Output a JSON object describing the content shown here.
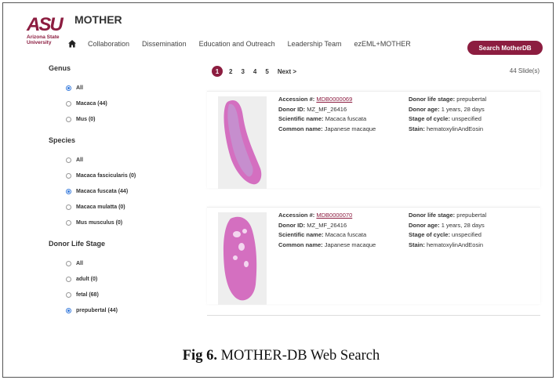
{
  "header": {
    "logo_text": "ASU",
    "logo_sub1": "Arizona State",
    "logo_sub2": "University",
    "app_title": "MOTHER",
    "nav_items": [
      "Collaboration",
      "Dissemination",
      "Education and Outreach",
      "Leadership Team",
      "ezEML+MOTHER"
    ],
    "search_button": "Search MotherDB",
    "home_icon": "home-icon"
  },
  "filters": {
    "genus": {
      "title": "Genus",
      "options": [
        {
          "label": "All",
          "selected": true
        },
        {
          "label": "Macaca (44)",
          "selected": false
        },
        {
          "label": "Mus (0)",
          "selected": false
        }
      ]
    },
    "species": {
      "title": "Species",
      "options": [
        {
          "label": "All",
          "selected": false
        },
        {
          "label": "Macaca fascicularis (0)",
          "selected": false
        },
        {
          "label": "Macaca fuscata (44)",
          "selected": true
        },
        {
          "label": "Macaca mulatta (0)",
          "selected": false
        },
        {
          "label": "Mus musculus (0)",
          "selected": false
        }
      ]
    },
    "donor_life_stage": {
      "title": "Donor Life Stage",
      "options": [
        {
          "label": "All",
          "selected": false
        },
        {
          "label": "adult (0)",
          "selected": false
        },
        {
          "label": "fetal (68)",
          "selected": false
        },
        {
          "label": "prepubertal (44)",
          "selected": true
        }
      ]
    }
  },
  "pagination": {
    "pages": [
      "1",
      "2",
      "3",
      "4",
      "5"
    ],
    "active": "1",
    "next": "Next >",
    "count": "44 Slide(s)"
  },
  "results": [
    {
      "accession_label": "Accession #:",
      "accession": "MDB0000069",
      "donor_id_label": "Donor ID:",
      "donor_id": "MZ_MF_26416",
      "sci_label": "Scientific name:",
      "sci": "Macaca fuscata",
      "common_label": "Common name:",
      "common": "Japanese macaque",
      "life_stage_label": "Donor life stage:",
      "life_stage": "prepubertal",
      "age_label": "Donor age:",
      "age": "1 years, 28 days",
      "cycle_label": "Stage of cycle:",
      "cycle": "unspecified",
      "stain_label": "Stain:",
      "stain": "hematoxylinAndEosin"
    },
    {
      "accession_label": "Accession #:",
      "accession": "MDB0000070",
      "donor_id_label": "Donor ID:",
      "donor_id": "MZ_MF_26416",
      "sci_label": "Scientific name:",
      "sci": "Macaca fuscata",
      "common_label": "Common name:",
      "common": "Japanese macaque",
      "life_stage_label": "Donor life stage:",
      "life_stage": "prepubertal",
      "age_label": "Donor age:",
      "age": "1 years, 28 days",
      "cycle_label": "Stage of cycle:",
      "cycle": "unspecified",
      "stain_label": "Stain:",
      "stain": "hematoxylinAndEosin"
    }
  ],
  "caption": {
    "prefix": "Fig 6.",
    "text": " MOTHER-DB Web Search"
  },
  "colors": {
    "brand": "#8c1d40",
    "gold": "#ffc627",
    "radio_selected": "#3b7ddd",
    "tissue_pink": "#d46fc0"
  }
}
